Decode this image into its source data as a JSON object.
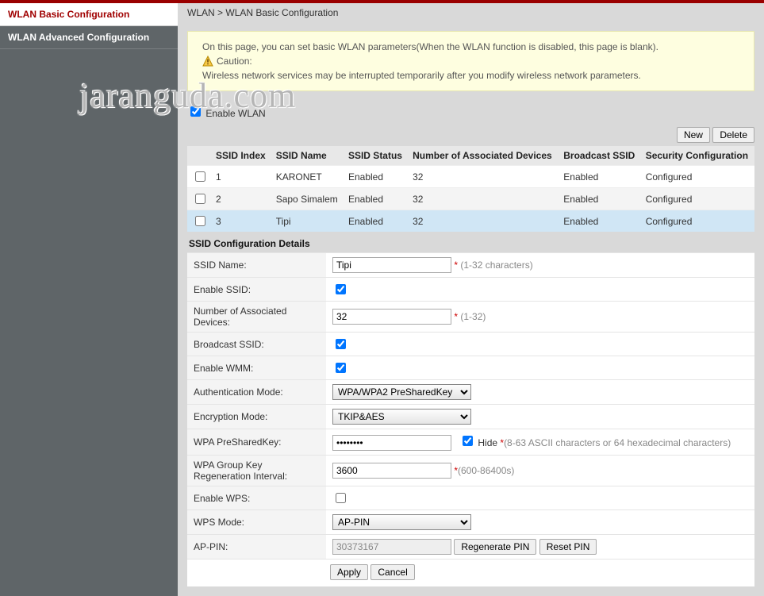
{
  "sidebar": {
    "items": [
      {
        "label": "WLAN Basic Configuration",
        "active": true
      },
      {
        "label": "WLAN Advanced Configuration",
        "active": false
      }
    ]
  },
  "breadcrumb": {
    "root": "WLAN",
    "sep": ">",
    "current": "WLAN Basic Configuration"
  },
  "notice": {
    "line1": "On this page, you can set basic WLAN parameters(When the WLAN function is disabled, this page is blank).",
    "cautionLabel": "Caution:",
    "line2": "Wireless network services may be interrupted temporarily after you modify wireless network parameters."
  },
  "enableWlan": {
    "label": "Enable WLAN",
    "checked": true
  },
  "toolbar": {
    "new": "New",
    "delete": "Delete"
  },
  "table": {
    "headers": {
      "ssidIndex": "SSID Index",
      "ssidName": "SSID Name",
      "ssidStatus": "SSID Status",
      "numDevices": "Number of Associated Devices",
      "broadcast": "Broadcast SSID",
      "security": "Security Configuration"
    },
    "rows": [
      {
        "index": "1",
        "name": "KARONET",
        "status": "Enabled",
        "devices": "32",
        "broadcast": "Enabled",
        "security": "Configured"
      },
      {
        "index": "2",
        "name": "Sapo Simalem",
        "status": "Enabled",
        "devices": "32",
        "broadcast": "Enabled",
        "security": "Configured"
      },
      {
        "index": "3",
        "name": "Tipi",
        "status": "Enabled",
        "devices": "32",
        "broadcast": "Enabled",
        "security": "Configured"
      }
    ]
  },
  "details": {
    "title": "SSID Configuration Details",
    "labels": {
      "ssidName": "SSID Name:",
      "enableSsid": "Enable SSID:",
      "numDevices": "Number of Associated Devices:",
      "broadcast": "Broadcast SSID:",
      "enableWmm": "Enable WMM:",
      "authMode": "Authentication Mode:",
      "encMode": "Encryption Mode:",
      "psk": "WPA PreSharedKey:",
      "groupKey": "WPA Group Key Regeneration Interval:",
      "enableWps": "Enable WPS:",
      "wpsMode": "WPS Mode:",
      "apPin": "AP-PIN:"
    },
    "values": {
      "ssidName": "Tipi",
      "enableSsid": true,
      "numDevices": "32",
      "broadcast": true,
      "enableWmm": true,
      "authMode": "WPA/WPA2 PreSharedKey",
      "encMode": "TKIP&AES",
      "psk": "••••••••",
      "hideLabel": "Hide",
      "hideChecked": true,
      "groupKey": "3600",
      "enableWps": false,
      "wpsMode": "AP-PIN",
      "apPin": "30373167"
    },
    "hints": {
      "ssidName": "(1-32 characters)",
      "numDevices": "(1-32)",
      "psk": "(8-63 ASCII characters or 64 hexadecimal characters)",
      "groupKey": "(600-86400s)"
    },
    "buttons": {
      "regenPin": "Regenerate PIN",
      "resetPin": "Reset PIN",
      "apply": "Apply",
      "cancel": "Cancel"
    }
  },
  "watermark": "jaranguda.com"
}
